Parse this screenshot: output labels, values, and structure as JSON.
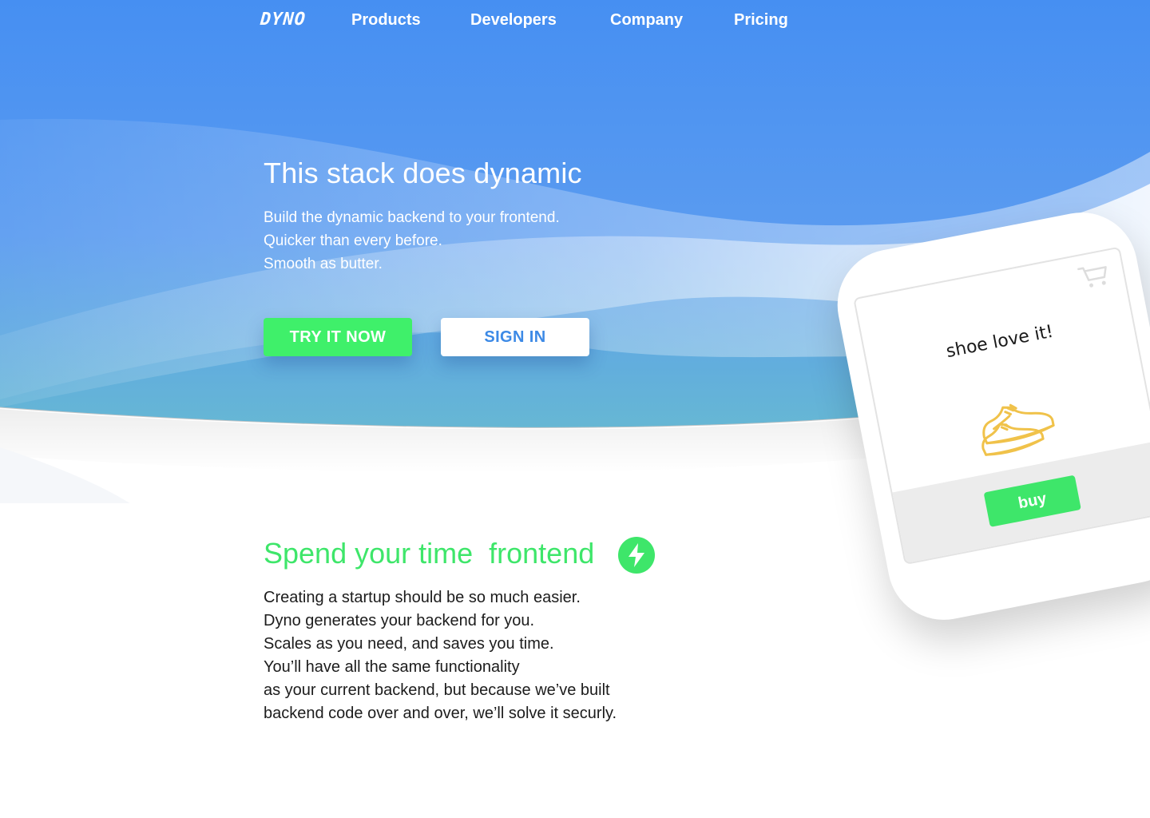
{
  "nav": {
    "logo": "DYNO",
    "links": [
      "Products",
      "Developers",
      "Company",
      "Pricing"
    ]
  },
  "hero": {
    "title": "This stack does dynamic",
    "subtitle_lines": [
      "Build the dynamic backend to your frontend.",
      "Quicker than every before.",
      "Smooth as butter."
    ],
    "primary_button": "TRY IT NOW",
    "secondary_button": "SIGN IN"
  },
  "feature": {
    "title": "Spend your time  frontend",
    "icon": "lightning-bolt-icon",
    "body_lines": [
      "Creating a startup should be so much easier.",
      "Dyno generates your backend for you.",
      "Scales as you need, and saves you time.",
      "You’ll have all the same functionality",
      "as your current backend, but because we’ve built",
      "backend code over and over, we’ll solve it securly."
    ]
  },
  "phone": {
    "caption": "shoe love it!",
    "icon_cart": "cart-icon",
    "icon_shoe": "sneaker-icon",
    "buy_label": "buy"
  },
  "colors": {
    "hero_blue": "#4a8ff0",
    "accent_green": "#3ff06a",
    "sign_in_text": "#3d8ae6",
    "shoe_yellow": "#f0c24a"
  }
}
